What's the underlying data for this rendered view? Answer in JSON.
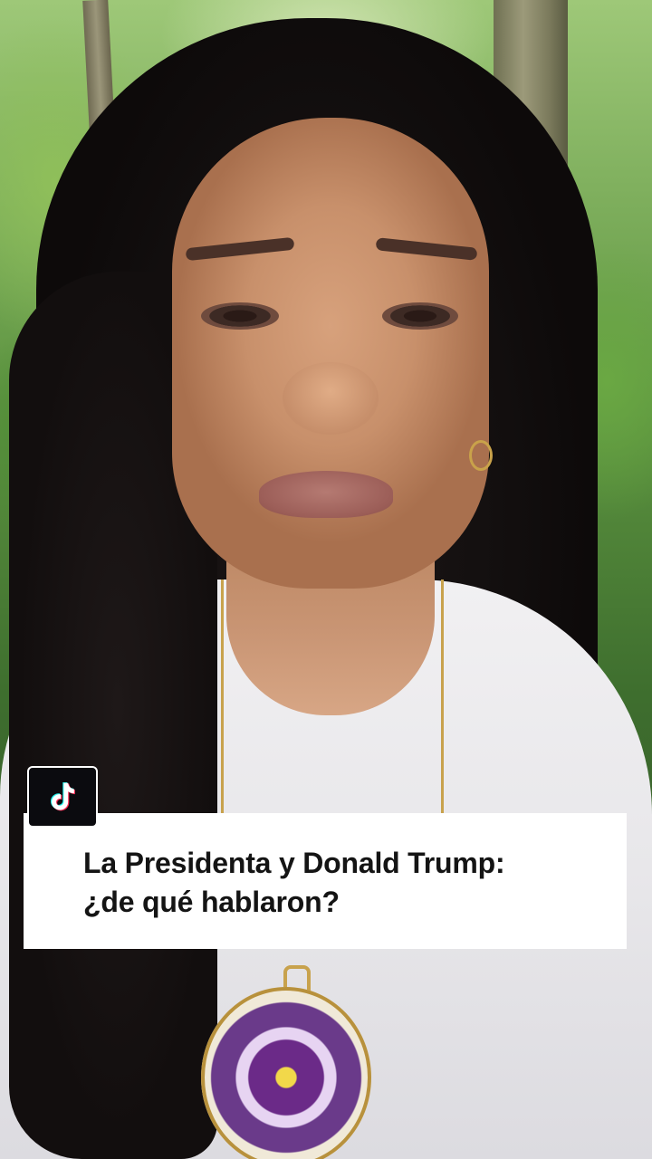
{
  "overlay": {
    "logo_icon": "tiktok-note-icon",
    "caption_line1": "La Presidenta y Donald Trump:",
    "caption_line2": "¿de qué hablaron?"
  },
  "colors": {
    "card_background": "#ffffff",
    "caption_text": "#141414",
    "badge_background": "#0b0b0f"
  }
}
